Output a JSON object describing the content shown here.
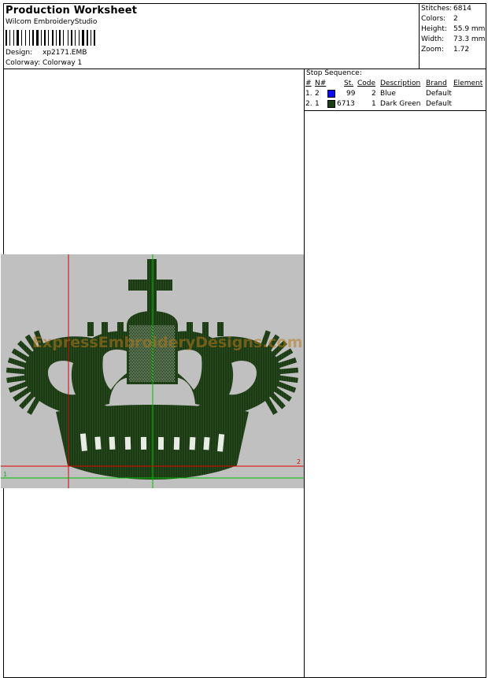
{
  "header": {
    "title": "Production Worksheet",
    "subtitle": "Wilcom EmbroideryStudio",
    "design_label": "Design:",
    "design_value": "xp2171.EMB",
    "colorway_label": "Colorway:",
    "colorway_value": "Colorway 1"
  },
  "stats": {
    "stitches_label": "Stitches:",
    "stitches_value": "6814",
    "colors_label": "Colors:",
    "colors_value": "2",
    "height_label": "Height:",
    "height_value": "55.9 mm",
    "width_label": "Width:",
    "width_value": "73.3 mm",
    "zoom_label": "Zoom:",
    "zoom_value": "1.72"
  },
  "stop_sequence": {
    "title": "Stop Sequence:",
    "headers": {
      "num": "#",
      "n": "N#",
      "st": "St.",
      "code": "Code",
      "description": "Description",
      "brand": "Brand",
      "element": "Element"
    },
    "rows": [
      {
        "num": "1.",
        "n": "2",
        "color": "#0a0aff",
        "st": "99",
        "code": "2",
        "description": "Blue",
        "brand": "Default"
      },
      {
        "num": "2.",
        "n": "1",
        "color": "#1a3d12",
        "st": "6713",
        "code": "1",
        "description": "Dark Green",
        "brand": "Default"
      }
    ]
  },
  "preview": {
    "background": "#c0c0c0",
    "thread_color": "#1c3a14",
    "watermark": "ExpressEmbroideryDesigns.com",
    "marker_x": "1",
    "marker_2": "2"
  }
}
